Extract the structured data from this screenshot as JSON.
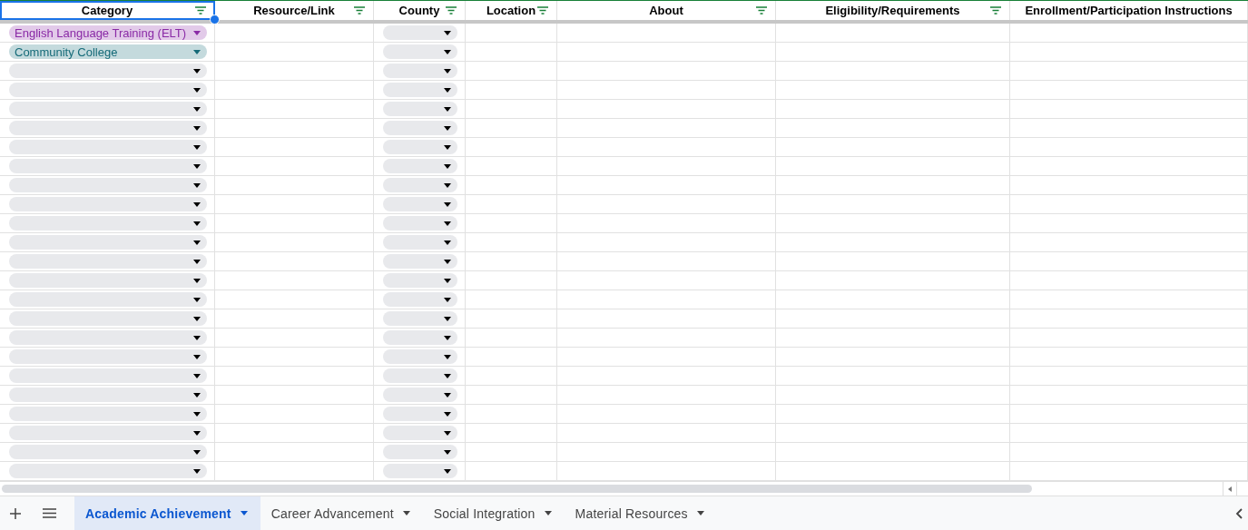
{
  "columns": [
    {
      "label": "Category",
      "filter": true,
      "selected": true
    },
    {
      "label": "Resource/Link",
      "filter": true,
      "selected": false
    },
    {
      "label": "County",
      "filter": true,
      "selected": false
    },
    {
      "label": "Location",
      "filter": true,
      "selected": false
    },
    {
      "label": "About",
      "filter": true,
      "selected": false
    },
    {
      "label": "Eligibility/Requirements",
      "filter": true,
      "selected": false
    },
    {
      "label": "Enrollment/Participation Instructions",
      "filter": false,
      "selected": false
    }
  ],
  "rows": [
    {
      "category": {
        "value": "English Language Training (ELT)",
        "color": "#8a2aa6"
      }
    },
    {
      "category": {
        "value": "Community College",
        "color": "#146a78"
      }
    },
    {},
    {},
    {},
    {},
    {},
    {},
    {},
    {},
    {},
    {},
    {},
    {},
    {},
    {},
    {},
    {},
    {},
    {},
    {},
    {},
    {},
    {}
  ],
  "sheet_tabs": [
    {
      "label": "Academic Achievement",
      "selected": true
    },
    {
      "label": "Career Advancement",
      "selected": false
    },
    {
      "label": "Social Integration",
      "selected": false
    },
    {
      "label": "Material Resources",
      "selected": false
    }
  ]
}
